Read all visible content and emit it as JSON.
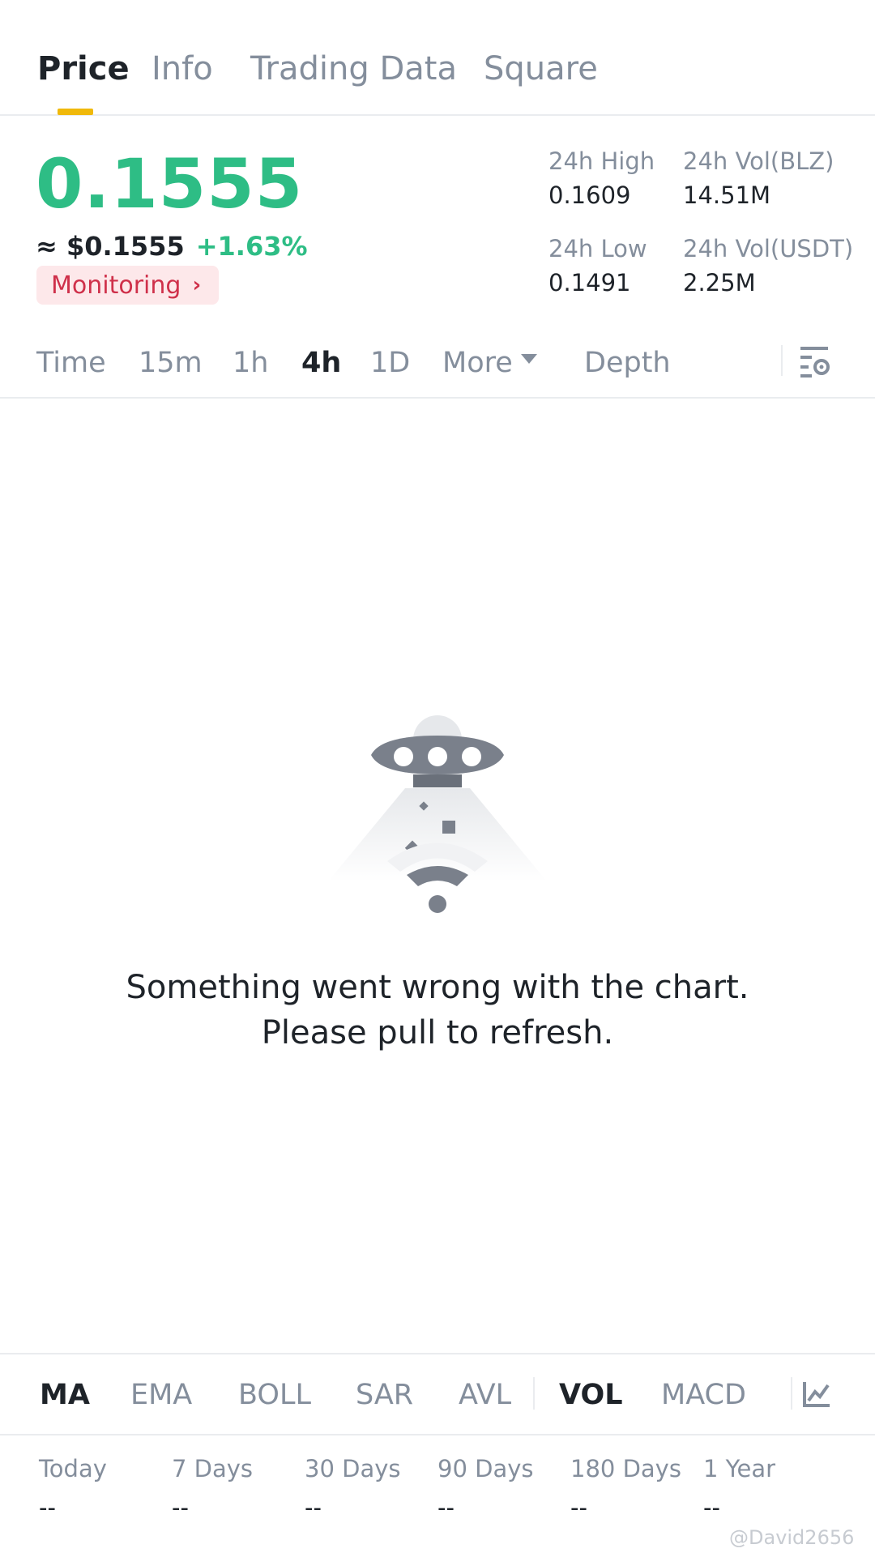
{
  "tabs": [
    {
      "label": "Price",
      "active": true
    },
    {
      "label": "Info",
      "active": false
    },
    {
      "label": "Trading Data",
      "active": false
    },
    {
      "label": "Square",
      "active": false
    }
  ],
  "price": {
    "last": "0.1555",
    "approx_usd": "≈ $0.1555",
    "change_pct": "+1.63%",
    "monitor_label": "Monitoring",
    "color_up": "#2ebd85"
  },
  "stats": {
    "high_label": "24h High",
    "high_value": "0.1609",
    "low_label": "24h Low",
    "low_value": "0.1491",
    "vol_base_label": "24h Vol(BLZ)",
    "vol_base_value": "14.51M",
    "vol_quote_label": "24h Vol(USDT)",
    "vol_quote_value": "2.25M"
  },
  "intervals": [
    {
      "label": "Time",
      "active": false
    },
    {
      "label": "15m",
      "active": false
    },
    {
      "label": "1h",
      "active": false
    },
    {
      "label": "4h",
      "active": true
    },
    {
      "label": "1D",
      "active": false
    },
    {
      "label": "More",
      "active": false
    },
    {
      "label": "Depth",
      "active": false
    }
  ],
  "error": {
    "line1": "Something went wrong with the chart.",
    "line2": "Please pull to refresh.",
    "icon": "ufo-no-connection-illustration"
  },
  "indicators": [
    {
      "label": "MA",
      "active": true
    },
    {
      "label": "EMA",
      "active": false
    },
    {
      "label": "BOLL",
      "active": false
    },
    {
      "label": "SAR",
      "active": false
    },
    {
      "label": "AVL",
      "active": false
    },
    {
      "label": "VOL",
      "active": true
    },
    {
      "label": "MACD",
      "active": false
    }
  ],
  "performance": [
    {
      "label": "Today",
      "value": "--"
    },
    {
      "label": "7 Days",
      "value": "--"
    },
    {
      "label": "30 Days",
      "value": "--"
    },
    {
      "label": "90 Days",
      "value": "--"
    },
    {
      "label": "180 Days",
      "value": "--"
    },
    {
      "label": "1 Year",
      "value": "--"
    }
  ],
  "watermark": "@David2656",
  "colors": {
    "accent": "#f0b90b",
    "up": "#2ebd85",
    "monitor_text": "#cf304a",
    "monitor_bg": "#fde8ea",
    "muted": "#848e9c",
    "text": "#1e2329"
  }
}
